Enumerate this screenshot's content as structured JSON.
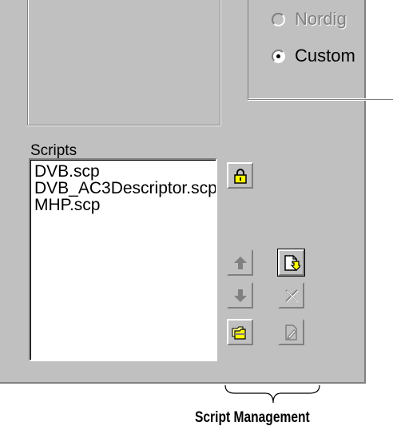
{
  "options": {
    "radios": [
      {
        "label": "Nordig",
        "checked": false,
        "enabled": false
      },
      {
        "label": "Custom",
        "checked": true,
        "enabled": true
      }
    ]
  },
  "scripts": {
    "label": "Scripts",
    "items": [
      "DVB.scp",
      "DVB_AC3Descriptor.scp",
      "MHP.scp"
    ]
  },
  "buttons": {
    "lock": {
      "icon": "lock-icon",
      "enabled": true
    },
    "move_up": {
      "icon": "arrow-up-icon",
      "enabled": false
    },
    "move_down": {
      "icon": "arrow-down-icon",
      "enabled": false
    },
    "new_script": {
      "icon": "new-script-icon",
      "enabled": true
    },
    "delete_script": {
      "icon": "delete-icon",
      "enabled": false
    },
    "open_folder": {
      "icon": "folder-icon",
      "enabled": true
    },
    "edit_script": {
      "icon": "edit-script-icon",
      "enabled": false
    }
  },
  "annotation": {
    "caption": "Script Management"
  }
}
